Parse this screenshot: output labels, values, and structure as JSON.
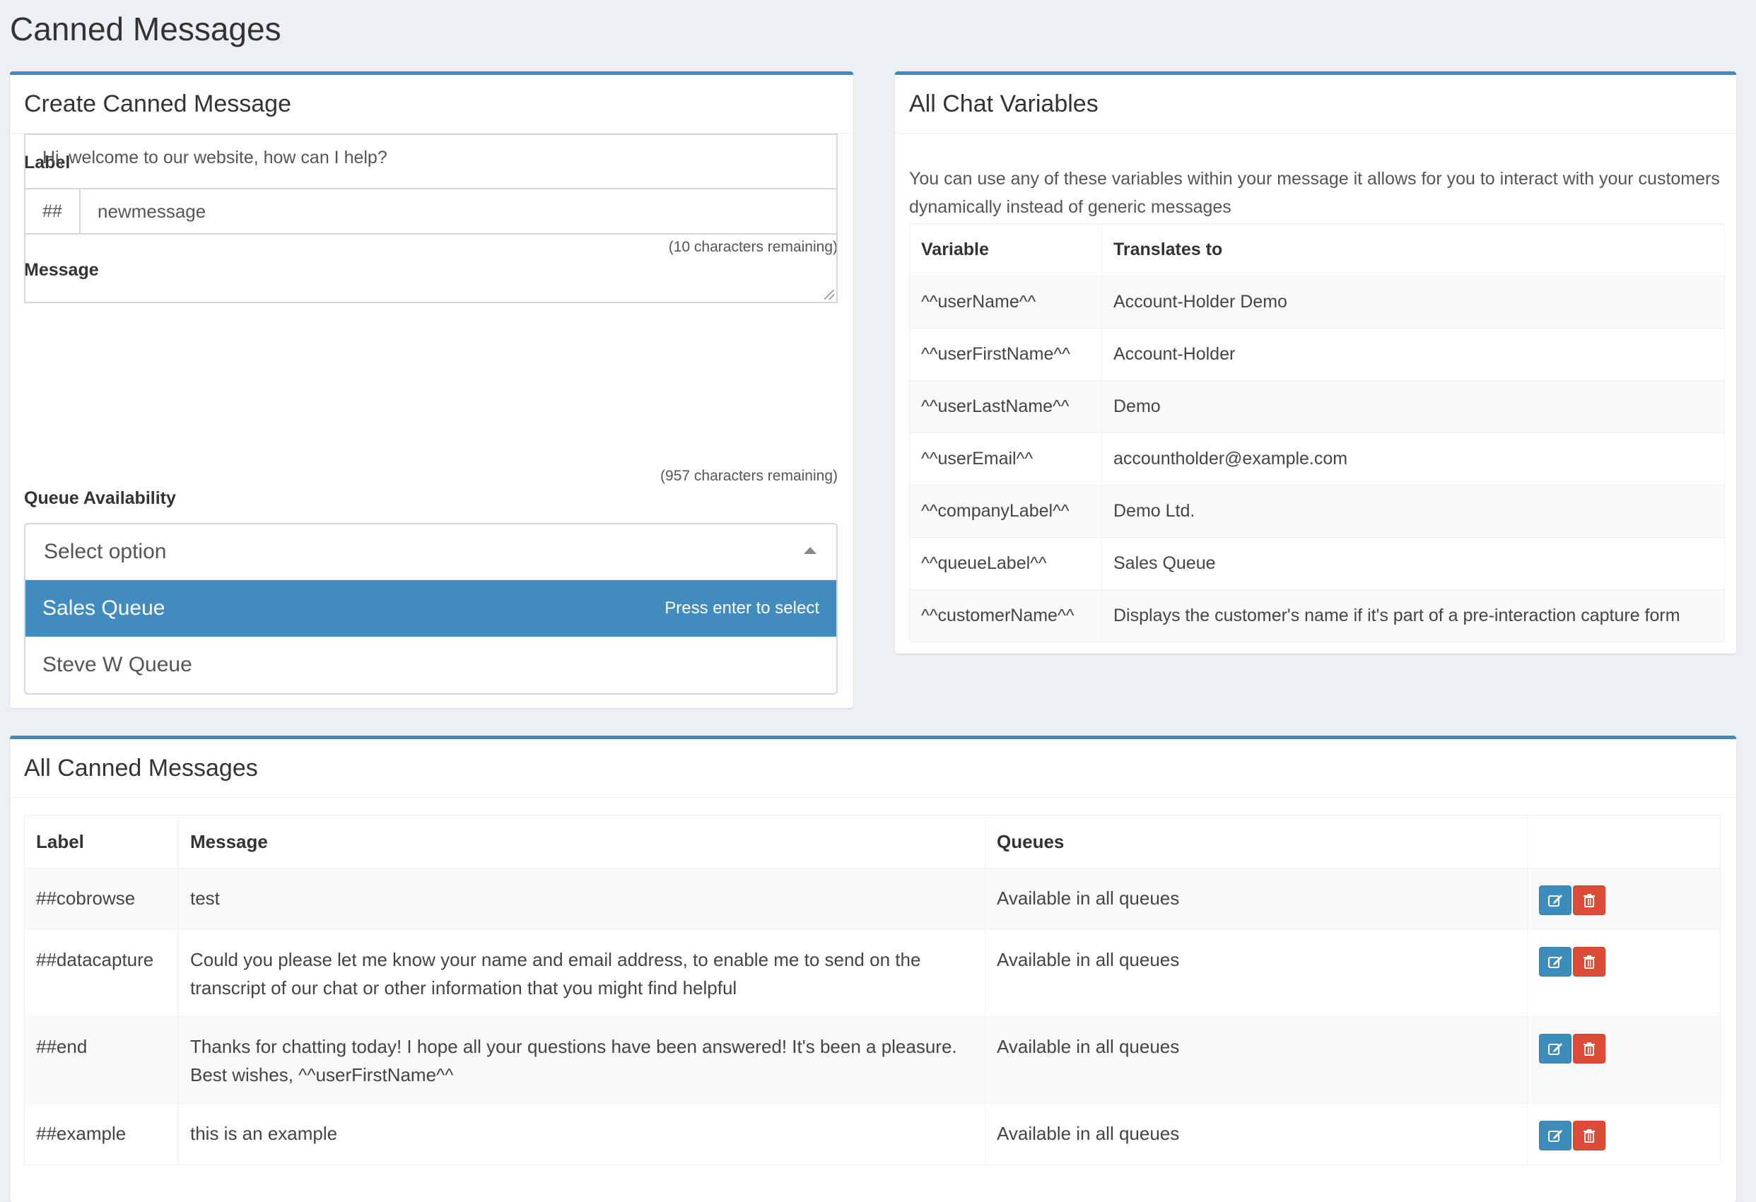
{
  "page": {
    "title": "Canned Messages"
  },
  "create": {
    "header": "Create Canned Message",
    "label_label": "Label",
    "label_prefix": "##",
    "label_value": "newmessage",
    "label_remaining": "(10 characters remaining)",
    "message_label": "Message",
    "message_value": "Hi, welcome to our website, how can I help?",
    "message_remaining": "(957 characters remaining)",
    "queue_label": "Queue Availability",
    "queue_placeholder": "Select option",
    "queue_options": [
      {
        "label": "Sales Queue",
        "hint": "Press enter to select"
      },
      {
        "label": "Steve W Queue"
      }
    ]
  },
  "variables": {
    "header": "All Chat Variables",
    "description": "You can use any of these variables within your message it allows for you to interact with your customers dynamically instead of generic messages",
    "columns": [
      "Variable",
      "Translates to"
    ],
    "rows": [
      [
        "^^userName^^",
        "Account-Holder Demo"
      ],
      [
        "^^userFirstName^^",
        "Account-Holder"
      ],
      [
        "^^userLastName^^",
        "Demo"
      ],
      [
        "^^userEmail^^",
        "accountholder@example.com"
      ],
      [
        "^^companyLabel^^",
        "Demo Ltd."
      ],
      [
        "^^queueLabel^^",
        "Sales Queue"
      ],
      [
        "^^customerName^^",
        "Displays the customer's name if it's part of a pre-interaction capture form"
      ]
    ]
  },
  "messages": {
    "header": "All Canned Messages",
    "columns": [
      "Label",
      "Message",
      "Queues",
      ""
    ],
    "rows": [
      {
        "label": "##cobrowse",
        "message": "test",
        "queues": "Available in all queues"
      },
      {
        "label": "##datacapture",
        "message": "Could you please let me know your name and email address, to enable me to send on the transcript of our chat or other information that you might find helpful",
        "queues": "Available in all queues"
      },
      {
        "label": "##end",
        "message": "Thanks for chatting today! I hope all your questions have been answered! It's been a pleasure. Best wishes, ^^userFirstName^^",
        "queues": "Available in all queues"
      },
      {
        "label": "##example",
        "message": "this is an example",
        "queues": "Available in all queues"
      }
    ]
  },
  "colors": {
    "accent": "#3c8dbc",
    "danger": "#dd4b39",
    "selected_option": "#428bbf",
    "background": "#ecf0f5"
  },
  "icons": {
    "edit": "edit-icon",
    "delete": "trash-icon",
    "dropdown": "caret-up-icon"
  }
}
